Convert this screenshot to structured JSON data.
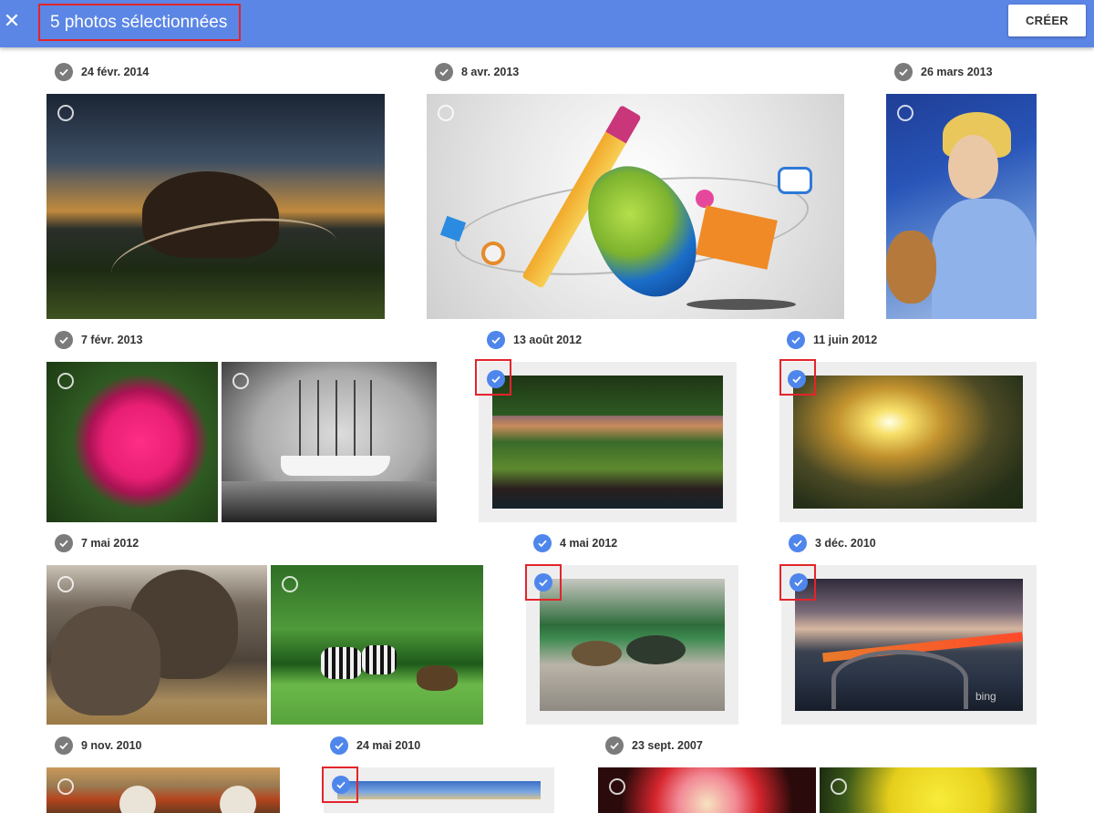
{
  "header": {
    "title": "5 photos sélectionnées",
    "create_label": "CRÉER",
    "close_symbol": "✕",
    "accent_color": "#5b86e5"
  },
  "groups": [
    {
      "date": "24 févr. 2014",
      "selected": false,
      "photos": [
        {
          "subject": "elephant-sunset",
          "selected": false
        }
      ]
    },
    {
      "date": "8 avr. 2013",
      "selected": false,
      "photos": [
        {
          "subject": "pencil-mouse-clipart",
          "selected": false
        }
      ]
    },
    {
      "date": "26 mars 2013",
      "selected": false,
      "photos": [
        {
          "subject": "child-painting",
          "selected": false
        }
      ]
    },
    {
      "date": "7 févr. 2013",
      "selected": false,
      "photos": [
        {
          "subject": "pink-rose",
          "selected": false
        },
        {
          "subject": "sailing-ship",
          "selected": false
        }
      ]
    },
    {
      "date": "13 août 2012",
      "selected": true,
      "photos": [
        {
          "subject": "park-sunset",
          "selected": true
        }
      ]
    },
    {
      "date": "11 juin 2012",
      "selected": true,
      "photos": [
        {
          "subject": "sunburst-field",
          "selected": true
        }
      ]
    },
    {
      "date": "7 mai 2012",
      "selected": false,
      "photos": [
        {
          "subject": "elephants",
          "selected": false
        },
        {
          "subject": "zebras",
          "selected": false
        }
      ]
    },
    {
      "date": "4 mai 2012",
      "selected": true,
      "photos": [
        {
          "subject": "ducks",
          "selected": true
        }
      ]
    },
    {
      "date": "3 déc. 2010",
      "selected": true,
      "photos": [
        {
          "subject": "coastal-bridge",
          "selected": true,
          "watermark": "bing"
        }
      ]
    },
    {
      "date": "9 nov. 2010",
      "selected": false,
      "photos": [
        {
          "subject": "boobies",
          "selected": false
        }
      ]
    },
    {
      "date": "24 mai 2010",
      "selected": true,
      "photos": [
        {
          "subject": "landscape",
          "selected": true
        }
      ]
    },
    {
      "date": "23 sept. 2007",
      "selected": false,
      "photos": [
        {
          "subject": "dahlia",
          "selected": false
        },
        {
          "subject": "yellow-flower",
          "selected": false
        }
      ]
    }
  ],
  "colors": {
    "selected": "#4f86ec",
    "unselected": "#7b7b7b",
    "highlight": "#e3242b"
  }
}
